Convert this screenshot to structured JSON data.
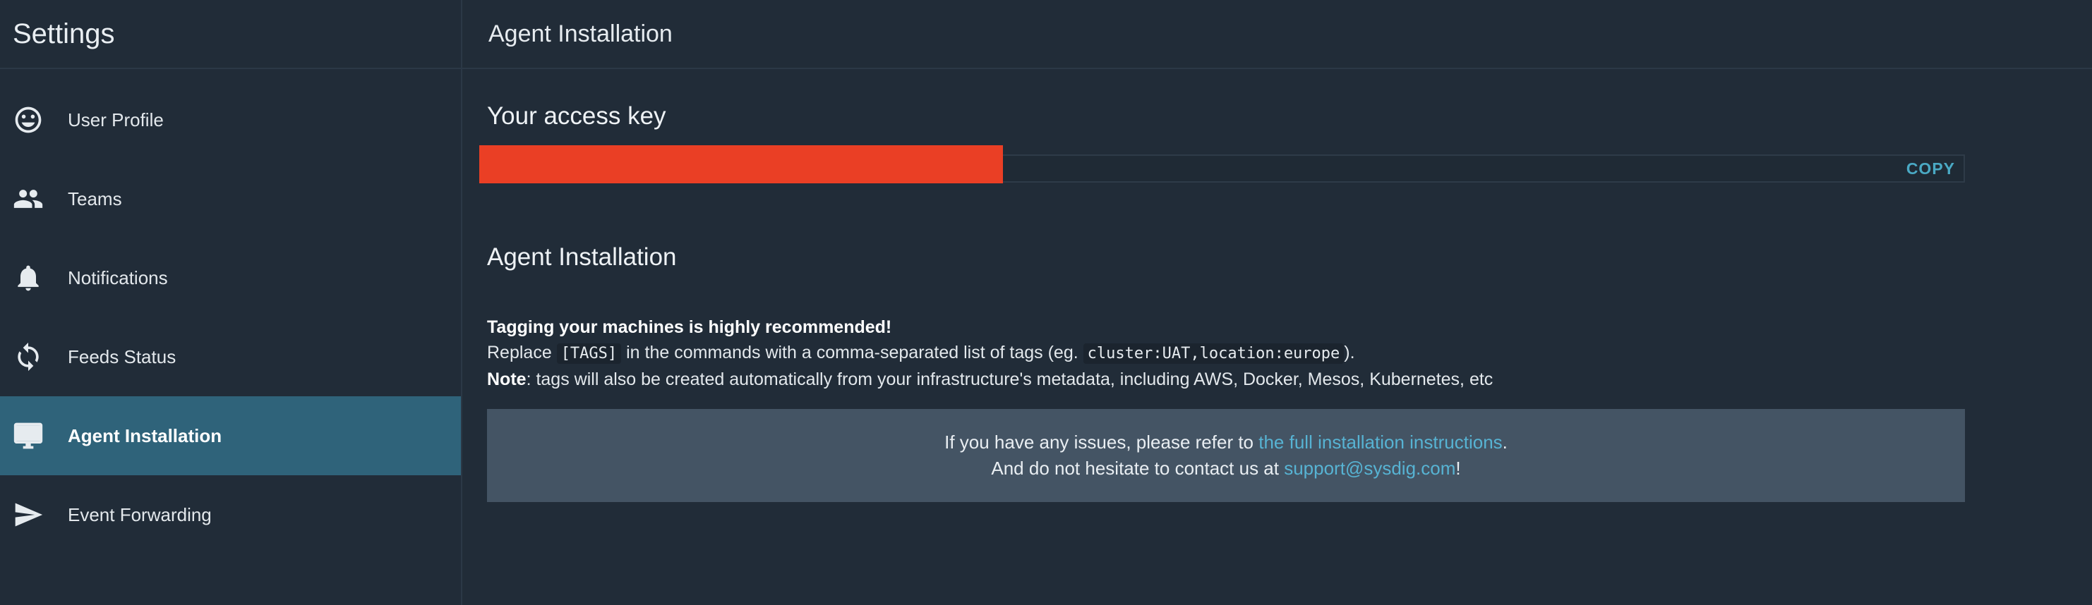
{
  "sidebar": {
    "title": "Settings",
    "items": [
      {
        "label": "User Profile",
        "icon": "smiley-face-icon",
        "active": false
      },
      {
        "label": "Teams",
        "icon": "people-icon",
        "active": false
      },
      {
        "label": "Notifications",
        "icon": "bell-icon",
        "active": false
      },
      {
        "label": "Feeds Status",
        "icon": "sync-icon",
        "active": false
      },
      {
        "label": "Agent Installation",
        "icon": "monitor-icon",
        "active": true
      },
      {
        "label": "Event Forwarding",
        "icon": "send-icon",
        "active": false
      }
    ]
  },
  "main": {
    "title": "Agent Installation",
    "access_key": {
      "heading": "Your access key",
      "copy_label": "COPY",
      "redaction_color": "#ea3f25"
    },
    "installation": {
      "heading": "Agent Installation",
      "tagging_bold": "Tagging your machines is highly recommended!",
      "replace_prefix": "Replace",
      "tags_code": "[TAGS]",
      "replace_middle": "in the commands with a comma-separated list of tags (eg.",
      "example_tag_1": "cluster:UAT",
      "example_separator": ",",
      "example_tag_2": "location:europe",
      "replace_suffix": ").",
      "note_bold": "Note",
      "note_text": ": tags will also be created automatically from your infrastructure's metadata, including AWS, Docker, Mesos, Kubernetes, etc"
    },
    "help": {
      "line1_prefix": "If you have any issues, please refer to",
      "line1_link": "the full installation instructions",
      "line1_suffix": ".",
      "line2_prefix": "And do not hesitate to contact us at",
      "line2_link": "support@sysdig.com",
      "line2_suffix": "!"
    }
  },
  "colors": {
    "background": "#212c38",
    "active_nav": "#2f637a",
    "accent_link": "#57b3d3",
    "help_box": "#445464"
  }
}
